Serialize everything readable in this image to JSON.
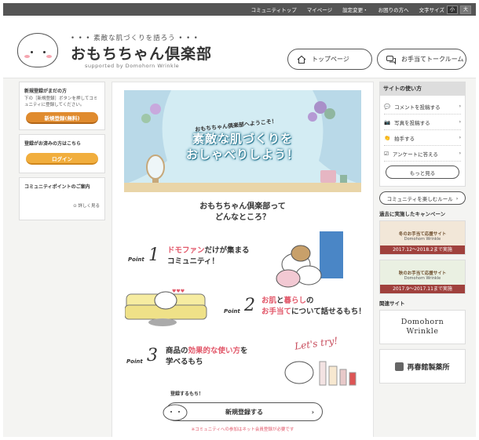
{
  "topnav": {
    "items": [
      "コミュニティトップ",
      "マイページ",
      "設定変更・",
      "お困りの方へ"
    ],
    "font_size_label": "文字サイズ",
    "size_small": "小",
    "size_large": "大"
  },
  "header": {
    "tagline": "• • • 素敵な肌づくりを語ろう • • •",
    "title": "おもちちゃん倶楽部",
    "supported": "supported by Domohorn Wrinkle",
    "top_button": "トップページ",
    "talk_button": "お手当てトークルーム"
  },
  "left": {
    "signup": {
      "heading": "新規登録がまだの方",
      "text": "下の［新規登録］ボタンを押してコミュニティに登録してください。",
      "button": "新規登録(無料)"
    },
    "login": {
      "heading": "登録がお済みの方はこちら",
      "button": "ログイン"
    },
    "points": {
      "heading": "コミュニティポイントのご案内",
      "link": "詳しく見る"
    }
  },
  "main": {
    "hero_welcome": "おもちちゃん倶楽部へようこそ！",
    "hero_line1": "素敵な肌づくりを",
    "hero_line2": "おしゃべりしよう！",
    "intro_line1": "おもちちゃん倶楽部って",
    "intro_line2": "どんなところ？",
    "point_label": "Point",
    "point1": {
      "num": "1",
      "hl": "ドモファン",
      "rest1": "だけが集まる",
      "line2": "コミュニティ！"
    },
    "point2": {
      "num": "2",
      "hl1": "お肌",
      "mid": "と",
      "hl2": "暮らし",
      "rest1": "の",
      "hl3": "お手当て",
      "rest2": "について話せるもち！"
    },
    "point3": {
      "num": "3",
      "pre": "商品の",
      "hl": "効果的な使い方",
      "rest1": "を",
      "line2": "学べるもち"
    },
    "sign_bubble": "登録するもち！",
    "lets_try": "Let's try!",
    "register_button": "新規登録する",
    "register_note": "※コミュニティへの参加はネット会員登録が必要です"
  },
  "right": {
    "usage_heading": "サイトの使い方",
    "usage_items": [
      {
        "icon": "comment-icon",
        "label": "コメントを投稿する"
      },
      {
        "icon": "camera-icon",
        "label": "写真を投稿する"
      },
      {
        "icon": "clap-icon",
        "label": "拍手する"
      },
      {
        "icon": "check-icon",
        "label": "アンケートに答える"
      }
    ],
    "more": "もっと見る",
    "rules": "コミュニティを楽しむルール",
    "campaign_heading": "過去に実施したキャンペーン",
    "campaigns": [
      {
        "title": "冬のお手当て応援サイト",
        "brand": "Domohorn Wrinkle",
        "date": "2017.12〜2018.2まで実施"
      },
      {
        "title": "秋のお手当て応援サイト",
        "brand": "Domohorn Wrinkle",
        "date": "2017.9〜2017.11まで実施"
      }
    ],
    "related_heading": "関連サイト",
    "related": [
      {
        "line1": "Domohorn",
        "line2": "Wrinkle"
      },
      {
        "name": "再春館製薬所"
      }
    ]
  }
}
